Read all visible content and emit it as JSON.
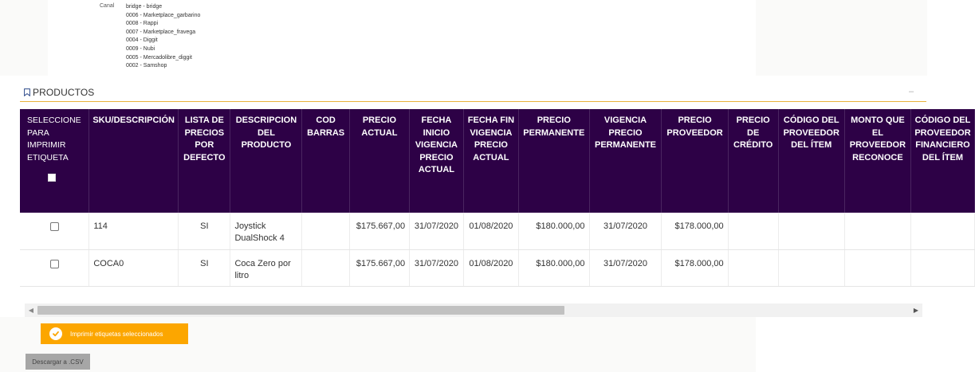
{
  "filters": {
    "canal_label": "Canal",
    "canal_items": [
      "bridge - bridge",
      "0006 - Marketplace_garbarino",
      "0008 - Rappi",
      "0007 - Marketplace_fravega",
      "0004 - Diggit",
      "0009 - Nubi",
      "0005 - Mercadolibre_diggit",
      "0002 - Samshop"
    ]
  },
  "section": {
    "title": "PRODUCTOS",
    "collapse_symbol": "–",
    "accent_color": "#e8b23c"
  },
  "table": {
    "header_bg": "#2d0146",
    "headers": {
      "select": "SELECCIONE PARA IMPRIMIR ETIQUETA",
      "sku": "SKU/DESCRIPCIÓN",
      "lista": "LISTA DE PRECIOS POR DEFECTO",
      "descripcion": "DESCRIPCION DEL PRODUCTO",
      "cod_barras": "COD BARRAS",
      "precio_actual": "PRECIO ACTUAL",
      "fecha_inicio": "FECHA INICIO VIGENCIA PRECIO ACTUAL",
      "fecha_fin": "FECHA FIN VIGENCIA PRECIO ACTUAL",
      "precio_permanente": "PRECIO PERMANENTE",
      "vigencia_permanente": "VIGENCIA PRECIO PERMANENTE",
      "precio_proveedor": "PRECIO PROVEEDOR",
      "precio_credito": "PRECIO DE CRÉDITO",
      "codigo_proveedor": "CÓDIGO DEL PROVEEDOR DEL ÍTEM",
      "monto_proveedor": "MONTO QUE EL PROVEEDOR RECONOCE",
      "codigo_financiero": "CÓDIGO DEL PROVEEDOR FINANCIERO DEL ÍTEM"
    },
    "rows": [
      {
        "sku": "114",
        "lista": "SI",
        "descripcion": "Joystick DualShock 4",
        "cod_barras": "",
        "precio_actual": "$175.667,00",
        "fecha_inicio": "31/07/2020",
        "fecha_fin": "01/08/2020",
        "precio_permanente": "$180.000,00",
        "vigencia_permanente": "31/07/2020",
        "precio_proveedor": "$178.000,00",
        "precio_credito": "",
        "codigo_proveedor": "",
        "monto_proveedor": "",
        "codigo_financiero": ""
      },
      {
        "sku": "COCA0",
        "lista": "SI",
        "descripcion": "Coca Zero por litro",
        "cod_barras": "",
        "precio_actual": "$175.667,00",
        "fecha_inicio": "31/07/2020",
        "fecha_fin": "01/08/2020",
        "precio_permanente": "$180.000,00",
        "vigencia_permanente": "31/07/2020",
        "precio_proveedor": "$178.000,00",
        "precio_credito": "",
        "codigo_proveedor": "",
        "monto_proveedor": "",
        "codigo_financiero": ""
      }
    ]
  },
  "scrollbar": {
    "left_arrow": "◀",
    "right_arrow": "▶"
  },
  "actions": {
    "print_label": "Imprimir etiquetas seleccionados",
    "print_color": "#fca600",
    "csv_label": "Descargar a .CSV"
  }
}
